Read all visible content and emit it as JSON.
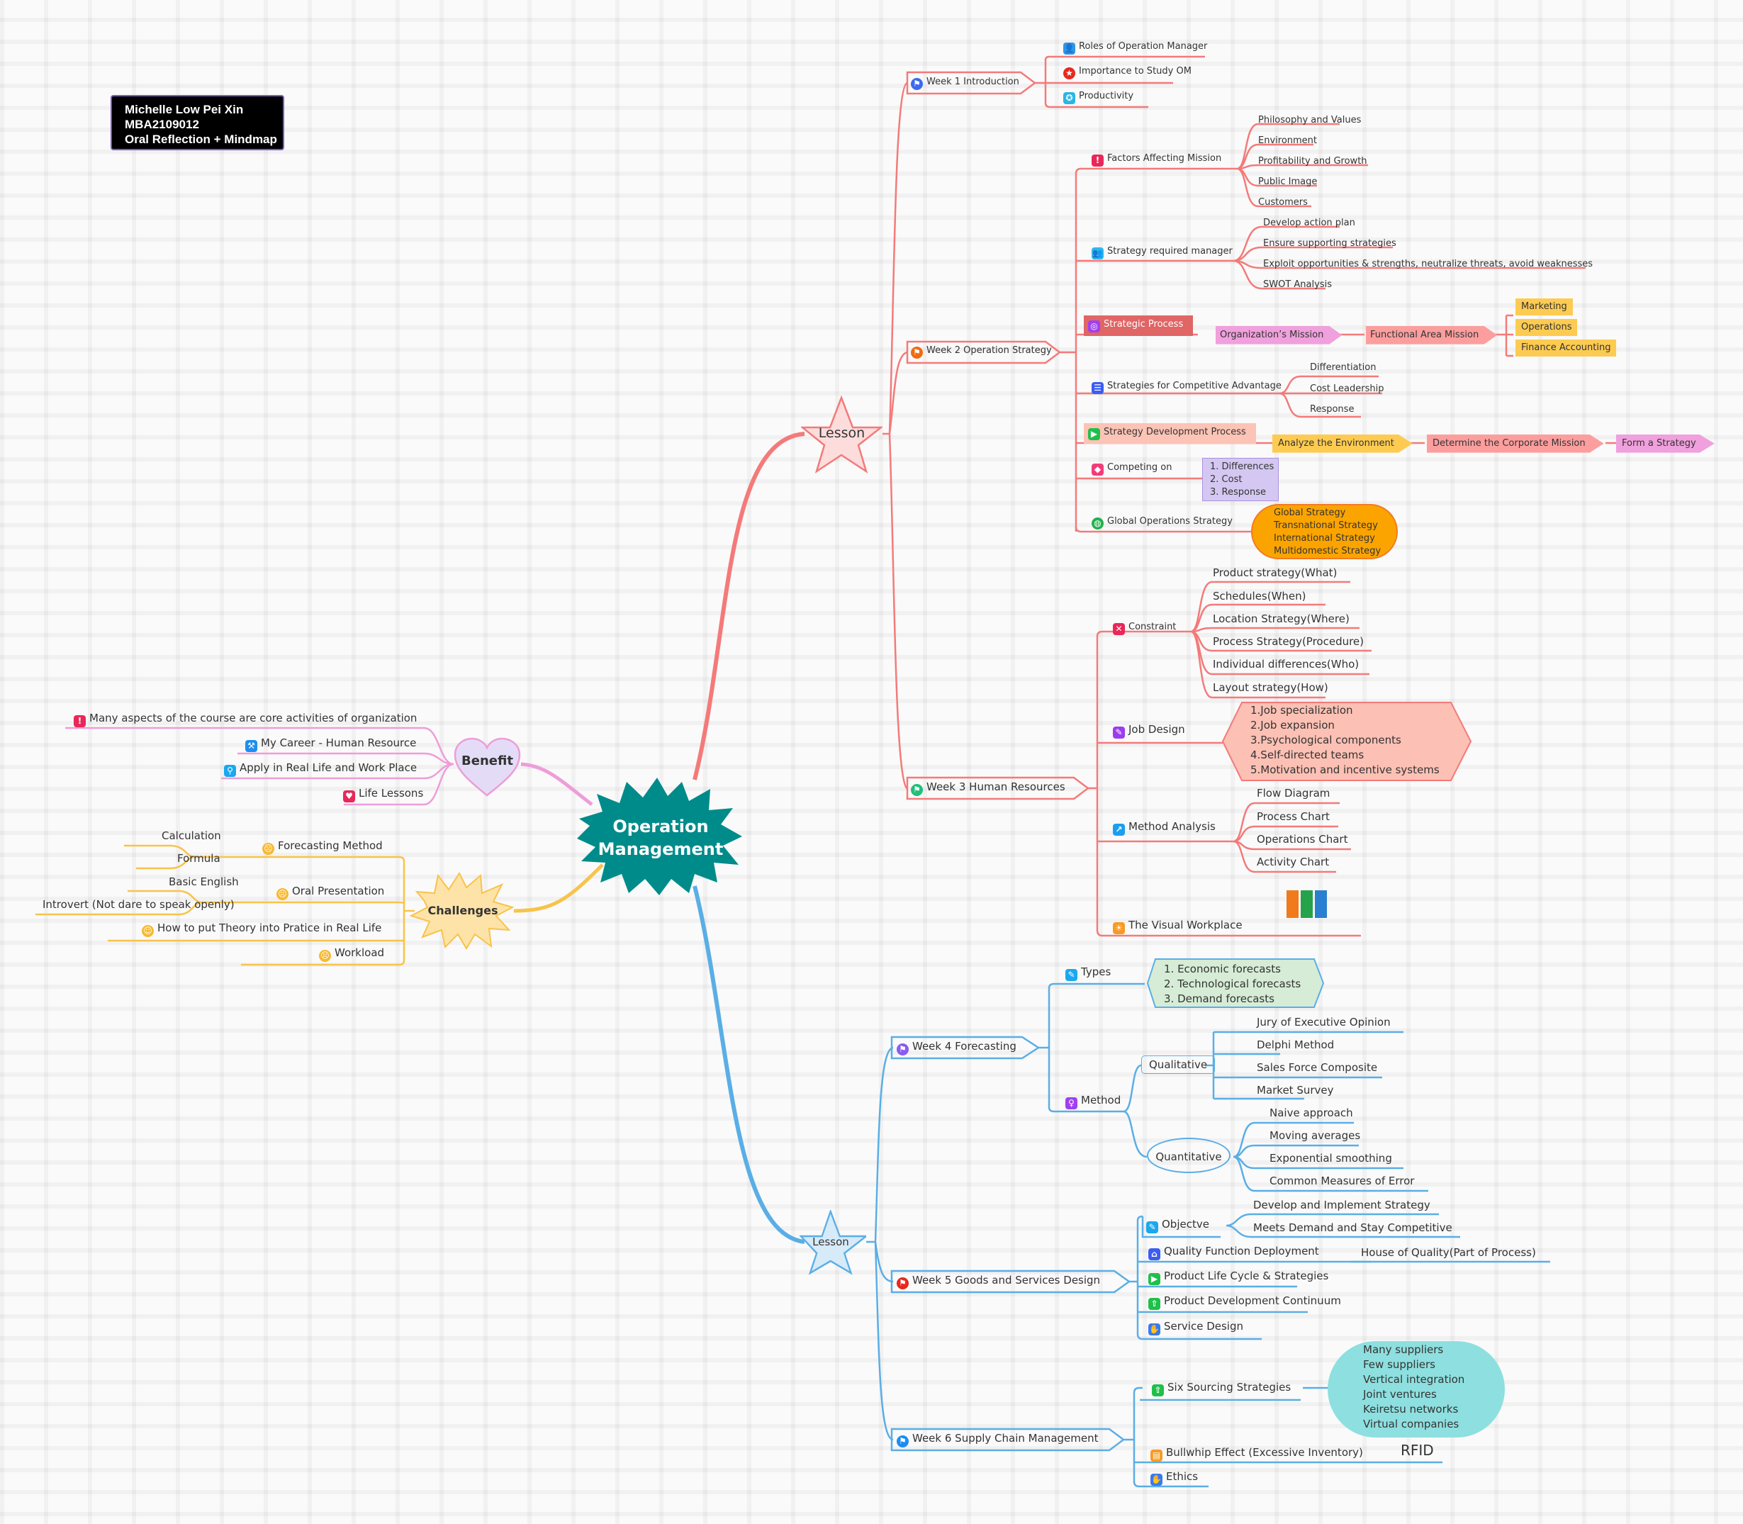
{
  "info_box": {
    "lines": [
      "Michelle Low Pei Xin",
      "MBA2109012",
      "Oral Reflection + Mindmap"
    ]
  },
  "central_topic": {
    "label": "Operation Management",
    "line1": "Operation",
    "line2": "Management",
    "color": "#008b8b"
  },
  "colors": {
    "red_branch": "#f47a7a",
    "blue_branch": "#5aaee6",
    "pink_branch": "#ee9dd9",
    "yellow_branch": "#f8c34a"
  },
  "lesson_top": {
    "label": "Lesson",
    "weeks": [
      {
        "label": "Week 1 Introduction",
        "icon": "flag-icon",
        "children": [
          {
            "label": "Roles of Operation Manager",
            "icon": "person-icon"
          },
          {
            "label": "Importance to Study OM",
            "icon": "star-icon"
          },
          {
            "label": "Productivity",
            "icon": "gear-icon"
          }
        ]
      },
      {
        "label": "Week 2 Operation Strategy",
        "icon": "flag-icon",
        "children": [
          {
            "label": "Factors Affecting Mission",
            "icon": "exclamation-icon",
            "children": [
              "Philosophy and Values",
              "Environment",
              "Profitability and Growth",
              "Public Image",
              "Customers"
            ]
          },
          {
            "label": "Strategy required manager",
            "icon": "people-icon",
            "children": [
              "Develop action plan",
              "Ensure supporting strategies",
              "Exploit opportunities & strengths, neutralize threats, avoid weaknesses",
              "SWOT Analysis"
            ]
          },
          {
            "label": "Strategic Process",
            "icon": "target-icon",
            "flow": [
              "Organization’s Mission",
              "Functional Area Mission"
            ],
            "areas": [
              "Marketing",
              "Operations",
              "Finance Accounting"
            ]
          },
          {
            "label": "Strategies for Competitive Advantage",
            "icon": "list-icon",
            "children": [
              "Differentiation",
              "Cost Leadership",
              "Response"
            ]
          },
          {
            "label": "Strategy Development Process",
            "icon": "play-icon",
            "flow": [
              "Analyze the Environment",
              "Determine the Corporate Mission",
              "Form a Strategy"
            ]
          },
          {
            "label": "Competing on",
            "icon": "gem-icon",
            "list": [
              "1. Differences",
              "2. Cost",
              "3. Response"
            ]
          },
          {
            "label": "Global Operations Strategy",
            "icon": "globe-icon",
            "list": [
              "Global Strategy",
              "Transnational Strategy",
              "International Strategy",
              "Multidomestic Strategy"
            ]
          }
        ]
      },
      {
        "label": "Week 3 Human Resources",
        "icon": "flag-icon",
        "children": [
          {
            "label": "Constraint",
            "icon": "x-icon",
            "children": [
              "Product strategy(What)",
              "Schedules(When)",
              "Location Strategy(Where)",
              "Process Strategy(Procedure)",
              "Individual differences(Who)",
              "Layout strategy(How)"
            ]
          },
          {
            "label": "Job Design",
            "icon": "pen-icon",
            "list": [
              "1.Job specialization",
              "2.Job expansion",
              "3.Psychological components",
              "4.Self-directed teams",
              "5.Motivation and incentive systems"
            ]
          },
          {
            "label": "Method Analysis",
            "icon": "chart-icon",
            "children": [
              "Flow Diagram",
              "Process Chart",
              "Operations Chart",
              "Activity Chart"
            ]
          },
          {
            "label": "The Visual Workplace",
            "icon": "sun-icon"
          }
        ]
      }
    ]
  },
  "lesson_bottom": {
    "label": "Lesson",
    "weeks": [
      {
        "label": "Week 4 Forecasting",
        "icon": "flag-icon",
        "types": {
          "label": "Types",
          "icon": "edit-icon",
          "list": [
            "1. Economic forecasts",
            "2. Technological forecasts",
            "3. Demand forecasts"
          ]
        },
        "method": {
          "label": "Method",
          "icon": "bulb-icon",
          "qualitative": {
            "label": "Qualitative",
            "children": [
              "Jury of Executive Opinion",
              "Delphi Method",
              "Sales Force Composite",
              "Market Survey"
            ]
          },
          "quantitative": {
            "label": "Quantitative",
            "children": [
              "Naive approach",
              "Moving averages",
              "Exponential smoothing",
              "Common Measures of Error"
            ]
          }
        }
      },
      {
        "label": "Week 5 Goods and Services Design",
        "icon": "flag-icon",
        "children": [
          {
            "label": "Objectve",
            "icon": "edit-icon",
            "children": [
              "Develop and Implement Strategy",
              "Meets Demand and Stay Competitive"
            ]
          },
          {
            "label": "Quality Function Deployment",
            "icon": "house-icon",
            "linked": "House of Quality(Part of Process)"
          },
          {
            "label": "Product Life Cycle & Strategies",
            "icon": "play-icon"
          },
          {
            "label": "Product Development Continuum",
            "icon": "rocket-icon"
          },
          {
            "label": "Service Design",
            "icon": "handshake-icon"
          }
        ]
      },
      {
        "label": "Week 6 Supply Chain Management",
        "icon": "flag-icon",
        "children": [
          {
            "label": "Six Sourcing Strategies",
            "icon": "rocket-icon",
            "list": [
              "Many suppliers",
              "Few suppliers",
              "Vertical integration",
              "Joint ventures",
              "Keiretsu networks",
              "Virtual companies"
            ]
          },
          {
            "label": "Bullwhip Effect (Excessive Inventory)",
            "icon": "folder-icon",
            "note": "RFID"
          },
          {
            "label": "Ethics",
            "icon": "handshake-icon"
          }
        ]
      }
    ]
  },
  "benefit": {
    "label": "Benefit",
    "children": [
      {
        "label": "Many aspects of the course are core activities of organization",
        "icon": "exclamation-icon"
      },
      {
        "label": "My Career - Human Resource",
        "icon": "career-icon"
      },
      {
        "label": "Apply in Real Life and Work Place",
        "icon": "search-icon"
      },
      {
        "label": "Life Lessons",
        "icon": "heart-icon"
      }
    ]
  },
  "challenges": {
    "label": "Challenges",
    "children": [
      {
        "label": "Forecasting Method",
        "icon": "stressed-face-icon",
        "children": [
          "Calculation",
          "Formula"
        ]
      },
      {
        "label": "Oral Presentation",
        "icon": "crying-face-icon",
        "children": [
          "Basic English",
          "Introvert (Not dare to speak openly)"
        ]
      },
      {
        "label": "How to put Theory into Pratice in Real Life",
        "icon": "thinking-face-icon"
      },
      {
        "label": "Workload",
        "icon": "crying-face-icon"
      }
    ]
  }
}
